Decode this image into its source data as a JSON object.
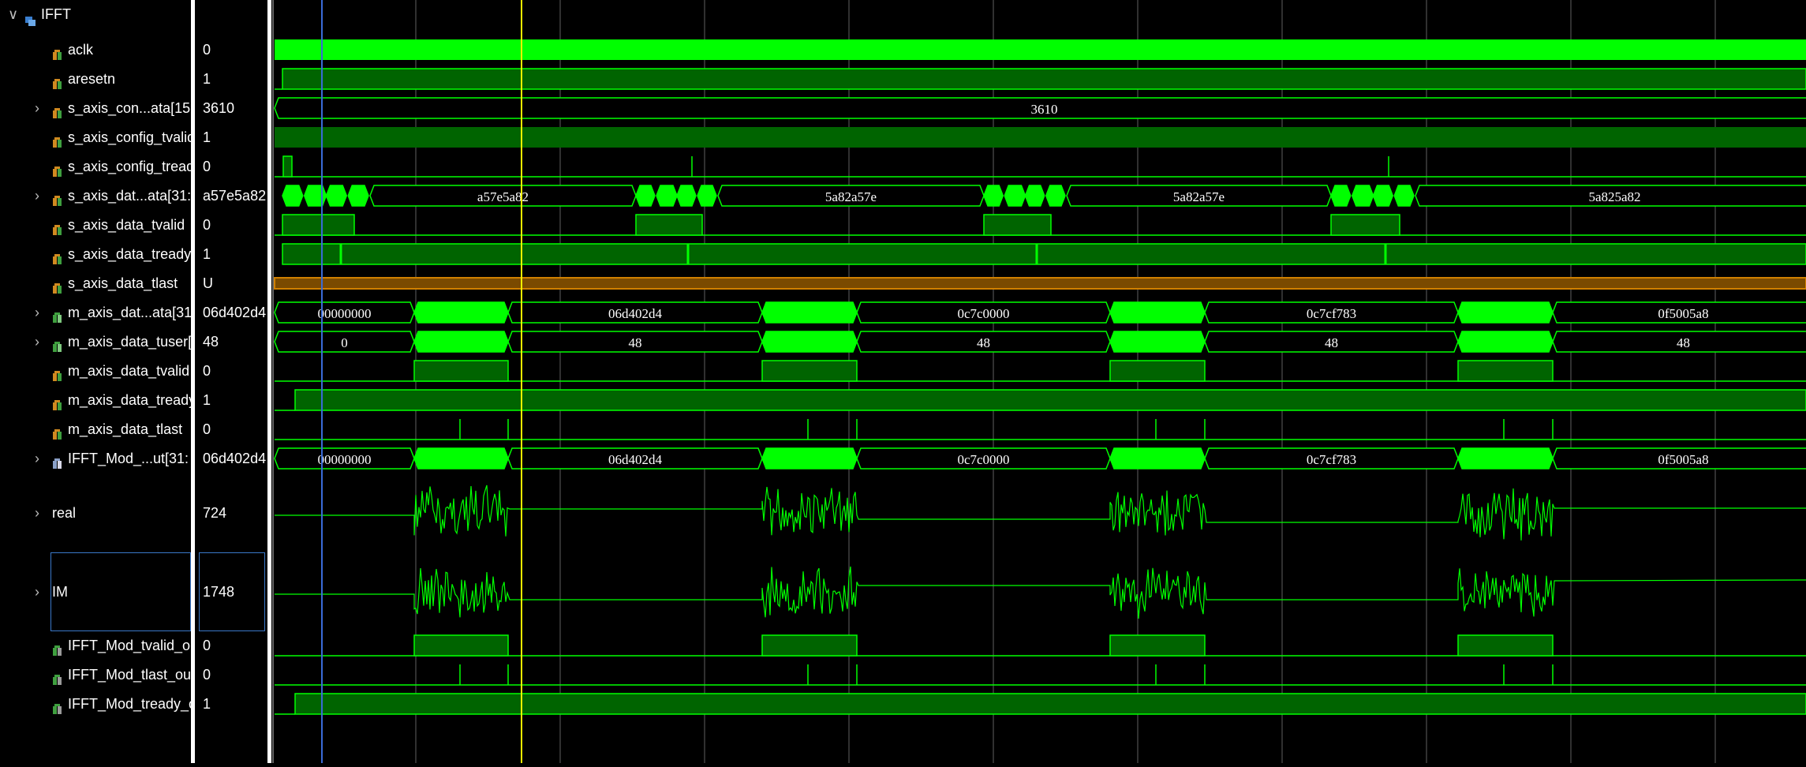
{
  "group": {
    "name": "IFFT",
    "expanded_glyph": "∨"
  },
  "colors": {
    "wave": "#00ff00",
    "wave_fill": "#006400",
    "bus_fill": "#005800",
    "undefined": "#d08000",
    "grid": "#7a7a7a",
    "cursor_yellow": "#f2f200",
    "cursor_blue": "#3a6bd8",
    "selection": "#3a78c8"
  },
  "signals": [
    {
      "name": "aclk",
      "value": "0",
      "type": "bit",
      "expandable": false,
      "icon": "input-bit-icon"
    },
    {
      "name": "aresetn",
      "value": "1",
      "type": "bit",
      "expandable": false,
      "icon": "input-bit-icon"
    },
    {
      "name": "s_axis_con...ata[15",
      "value": "3610",
      "type": "bus",
      "expandable": true,
      "icon": "input-bus-icon"
    },
    {
      "name": "s_axis_config_tvalid",
      "value": "1",
      "type": "bit",
      "expandable": false,
      "icon": "input-bit-icon"
    },
    {
      "name": "s_axis_config_tready",
      "value": "0",
      "type": "bit",
      "expandable": false,
      "icon": "input-bit-icon"
    },
    {
      "name": "s_axis_dat...ata[31:",
      "value": "a57e5a82",
      "type": "bus",
      "expandable": true,
      "icon": "input-bus-icon"
    },
    {
      "name": "s_axis_data_tvalid",
      "value": "0",
      "type": "bit",
      "expandable": false,
      "icon": "input-bit-icon"
    },
    {
      "name": "s_axis_data_tready",
      "value": "1",
      "type": "bit",
      "expandable": false,
      "icon": "input-bit-icon"
    },
    {
      "name": "s_axis_data_tlast",
      "value": "U",
      "type": "bit",
      "expandable": false,
      "icon": "input-bit-icon"
    },
    {
      "name": "m_axis_dat...ata[31:",
      "value": "06d402d4",
      "type": "bus",
      "expandable": true,
      "icon": "output-bus-icon"
    },
    {
      "name": "m_axis_data_tuser[",
      "value": "48",
      "type": "bus",
      "expandable": true,
      "icon": "output-bus-icon"
    },
    {
      "name": "m_axis_data_tvalid",
      "value": "0",
      "type": "bit",
      "expandable": false,
      "icon": "output-bit-icon"
    },
    {
      "name": "m_axis_data_tready",
      "value": "1",
      "type": "bit",
      "expandable": false,
      "icon": "input-bit-icon"
    },
    {
      "name": "m_axis_data_tlast",
      "value": "0",
      "type": "bit",
      "expandable": false,
      "icon": "output-bit-icon"
    },
    {
      "name": "IFFT_Mod_...ut[31:",
      "value": "06d402d4",
      "type": "bus",
      "expandable": true,
      "icon": "internal-bus-icon"
    },
    {
      "name": "real",
      "value": "724",
      "type": "analog",
      "expandable": true,
      "icon": ""
    },
    {
      "name": "IM",
      "value": "1748",
      "type": "analog",
      "expandable": true,
      "icon": "",
      "selected": true
    },
    {
      "name": "IFFT_Mod_tvalid_ou",
      "value": "0",
      "type": "bit",
      "expandable": false,
      "icon": "internal-bit-icon"
    },
    {
      "name": "IFFT_Mod_tlast_out",
      "value": "0",
      "type": "bit",
      "expandable": false,
      "icon": "internal-bit-icon"
    },
    {
      "name": "IFFT_Mod_tready_o",
      "value": "1",
      "type": "bit",
      "expandable": false,
      "icon": "internal-bit-icon"
    }
  ],
  "bus_labels": {
    "config": [
      "3610"
    ],
    "s_data": [
      "a57e5a82",
      "5a82a57e",
      "5a82a57e",
      "5a825a82"
    ],
    "m_data": [
      "00000000",
      "06d402d4",
      "0c7c0000",
      "0c7cf783",
      "0f5005a8"
    ],
    "tuser": [
      "0",
      "48",
      "48",
      "48",
      "48"
    ],
    "mod_out": [
      "00000000",
      "06d402d4",
      "0c7c0000",
      "0c7cf783",
      "0f5005a8"
    ]
  }
}
